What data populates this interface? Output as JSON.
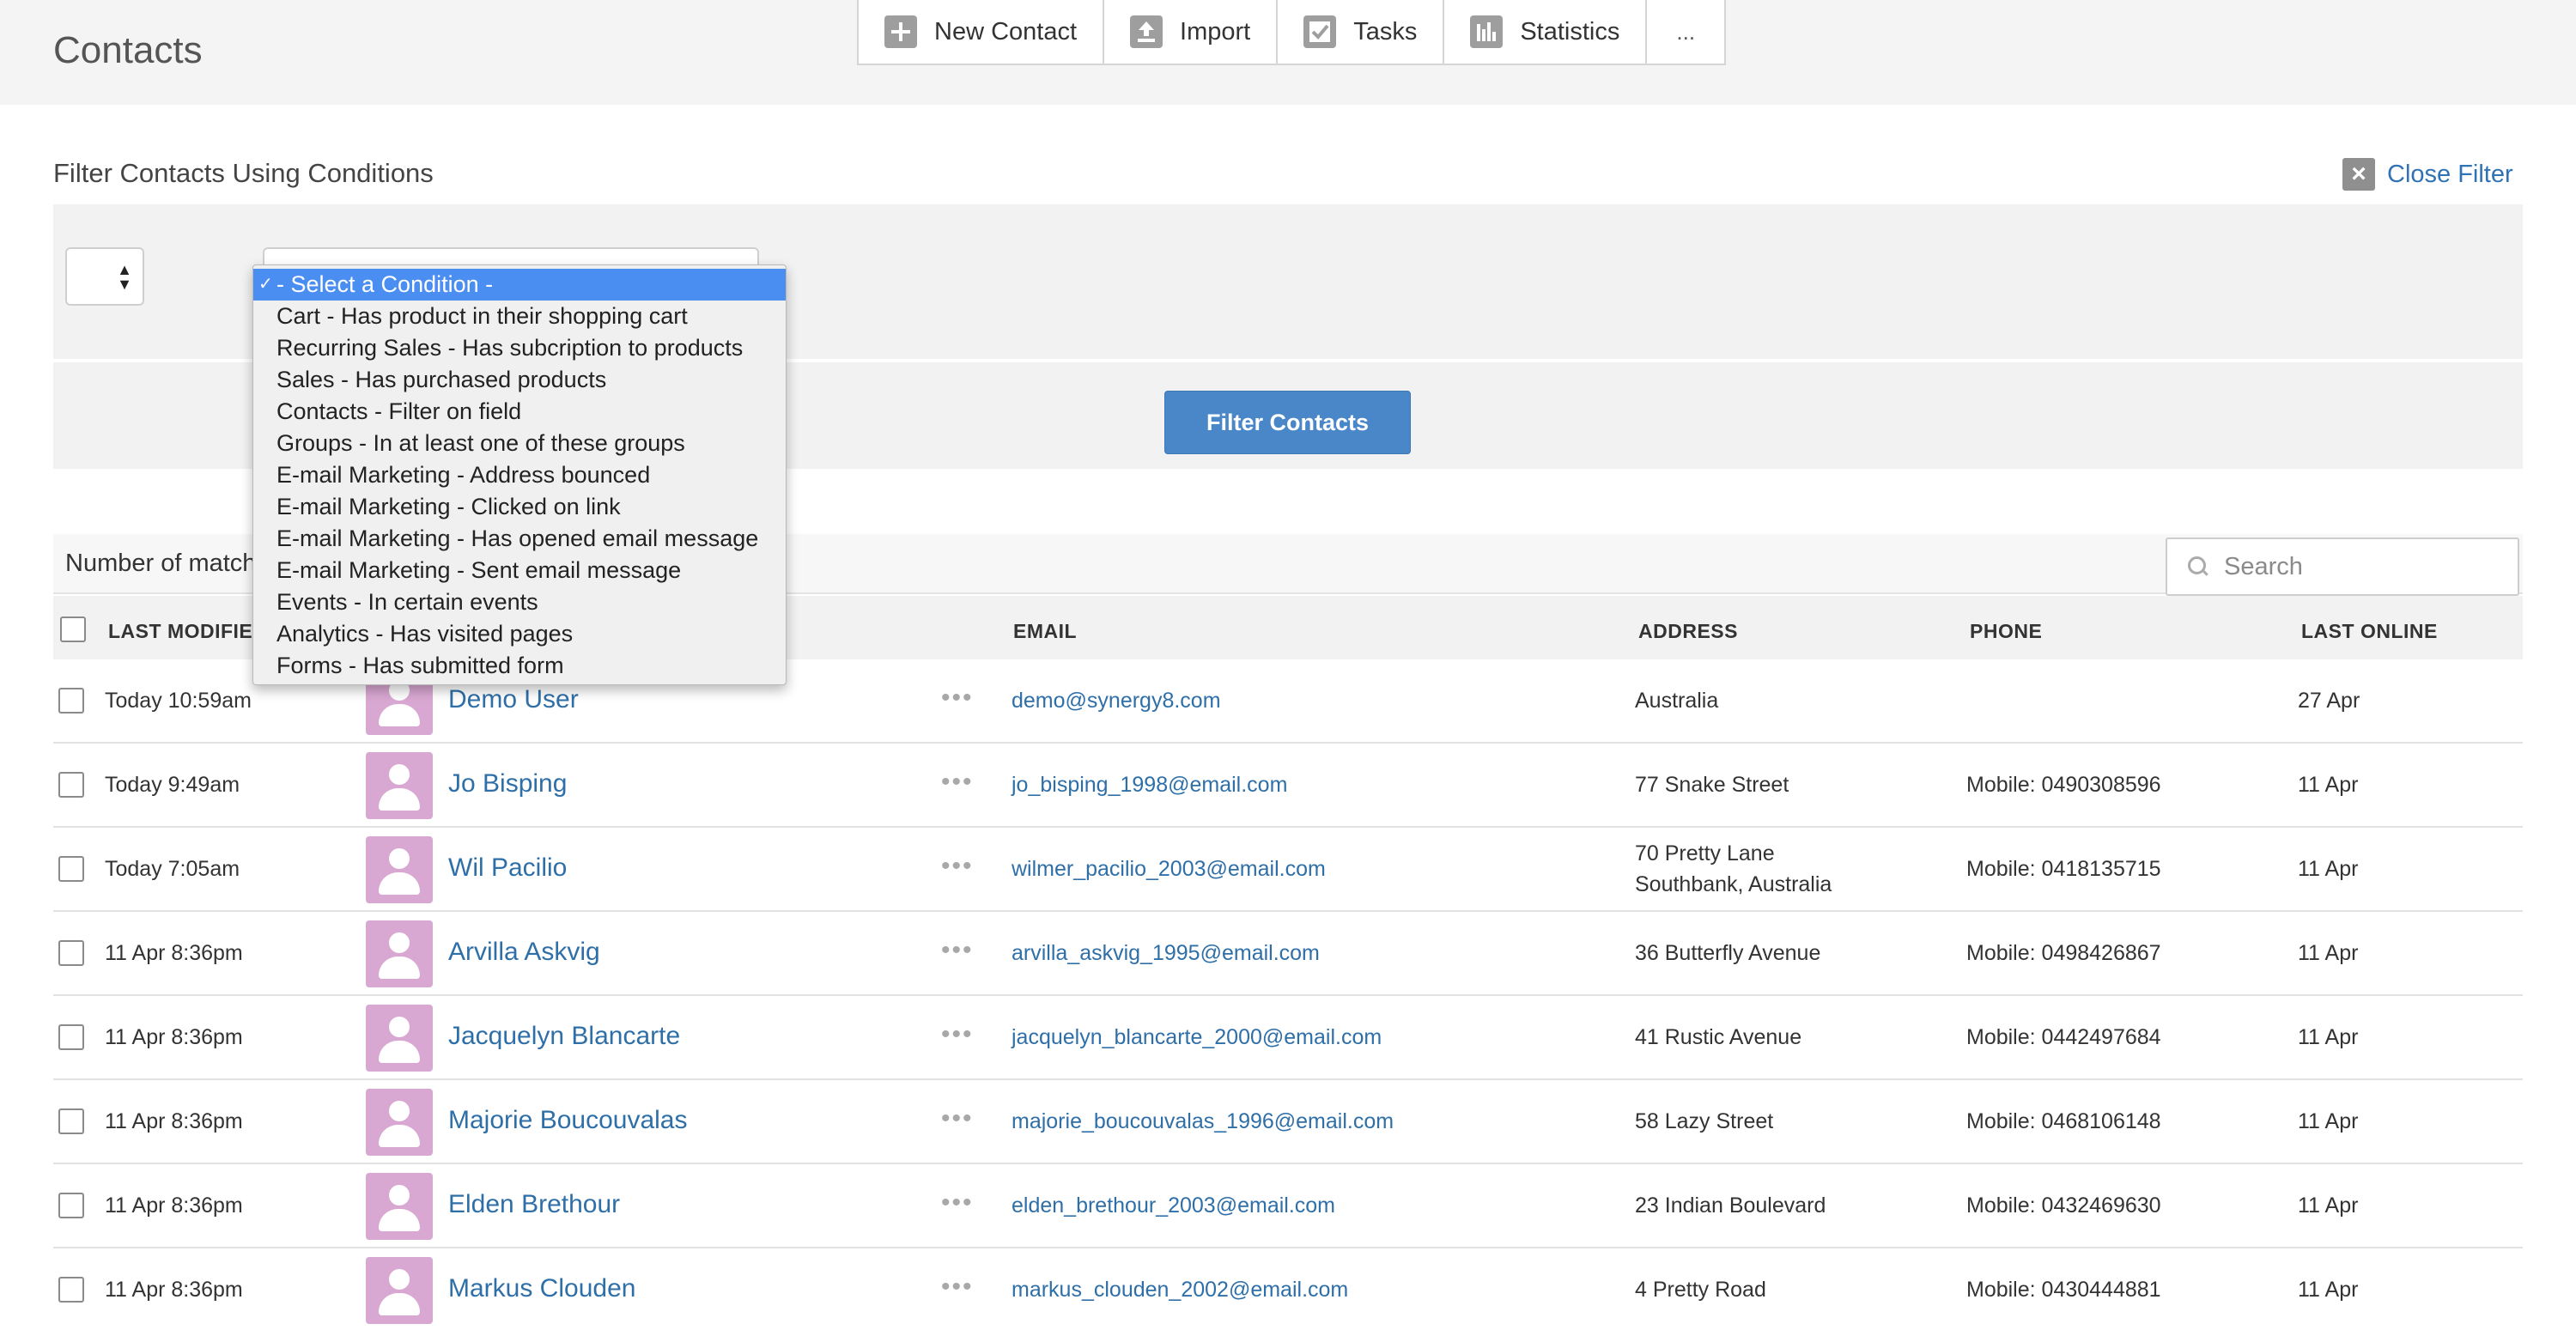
{
  "header": {
    "title": "Contacts",
    "toolbar": {
      "new_contact": "New Contact",
      "import": "Import",
      "tasks": "Tasks",
      "statistics": "Statistics",
      "more": "..."
    }
  },
  "filter": {
    "title": "Filter Contacts Using Conditions",
    "close_label": "Close Filter",
    "button_label": "Filter Contacts",
    "dropdown": {
      "check": "✓",
      "options": [
        "- Select a Condition -",
        "Cart - Has product in their shopping cart",
        "Recurring Sales - Has subcription to products",
        "Sales - Has purchased products",
        "Contacts - Filter on field",
        "Groups - In at least one of these groups",
        "E-mail Marketing - Address bounced",
        "E-mail Marketing - Clicked on link",
        "E-mail Marketing - Has opened email message",
        "E-mail Marketing - Sent email message",
        "Events - In certain events",
        "Analytics - Has visited pages",
        "Forms - Has submitted form"
      ]
    }
  },
  "results": {
    "matches_label": "Number of match",
    "search_placeholder": "Search"
  },
  "table": {
    "columns": {
      "last_modified": "LAST MODIFIED",
      "email": "EMAIL",
      "address": "ADDRESS",
      "phone": "PHONE",
      "last_online": "LAST ONLINE"
    },
    "rows": [
      {
        "modified": "Today 10:59am",
        "name": "Demo User",
        "email": "demo@synergy8.com",
        "address1": "Australia",
        "address2": "",
        "phone": "",
        "online": "27 Apr"
      },
      {
        "modified": "Today 9:49am",
        "name": "Jo Bisping",
        "email": "jo_bisping_1998@email.com",
        "address1": "77 Snake Street",
        "address2": "",
        "phone": "Mobile: 0490308596",
        "online": "11 Apr"
      },
      {
        "modified": "Today 7:05am",
        "name": "Wil Pacilio",
        "email": "wilmer_pacilio_2003@email.com",
        "address1": "70 Pretty Lane",
        "address2": "Southbank, Australia",
        "phone": "Mobile: 0418135715",
        "online": "11 Apr"
      },
      {
        "modified": "11 Apr 8:36pm",
        "name": "Arvilla Askvig",
        "email": "arvilla_askvig_1995@email.com",
        "address1": "36 Butterfly Avenue",
        "address2": "",
        "phone": "Mobile: 0498426867",
        "online": "11 Apr"
      },
      {
        "modified": "11 Apr 8:36pm",
        "name": "Jacquelyn Blancarte",
        "email": "jacquelyn_blancarte_2000@email.com",
        "address1": "41 Rustic Avenue",
        "address2": "",
        "phone": "Mobile: 0442497684",
        "online": "11 Apr"
      },
      {
        "modified": "11 Apr 8:36pm",
        "name": "Majorie Boucouvalas",
        "email": "majorie_boucouvalas_1996@email.com",
        "address1": "58 Lazy Street",
        "address2": "",
        "phone": "Mobile: 0468106148",
        "online": "11 Apr"
      },
      {
        "modified": "11 Apr 8:36pm",
        "name": "Elden Brethour",
        "email": "elden_brethour_2003@email.com",
        "address1": "23 Indian Boulevard",
        "address2": "",
        "phone": "Mobile: 0432469630",
        "online": "11 Apr"
      },
      {
        "modified": "11 Apr 8:36pm",
        "name": "Markus Clouden",
        "email": "markus_clouden_2002@email.com",
        "address1": "4 Pretty Road",
        "address2": "",
        "phone": "Mobile: 0430444881",
        "online": "11 Apr"
      }
    ]
  }
}
